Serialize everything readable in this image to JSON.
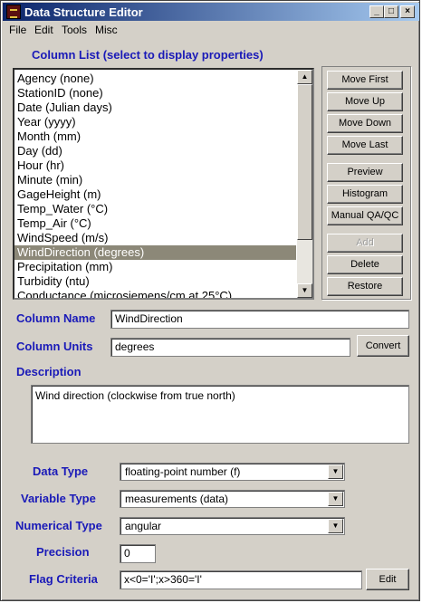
{
  "window": {
    "title": "Data Structure Editor"
  },
  "menu": [
    "File",
    "Edit",
    "Tools",
    "Misc"
  ],
  "column_list": {
    "label": "Column List (select to display properties)",
    "items": [
      "Agency (none)",
      "StationID (none)",
      "Date (Julian days)",
      "Year (yyyy)",
      "Month (mm)",
      "Day (dd)",
      "Hour (hr)",
      "Minute (min)",
      "GageHeight (m)",
      "Temp_Water (°C)",
      "Temp_Air (°C)",
      "WindSpeed (m/s)",
      "WindDirection (degrees)",
      "Precipitation (mm)",
      "Turbidity (ntu)",
      "Conductance (microsiemens/cm at 25°C)"
    ],
    "selected": "WindDirection (degrees)"
  },
  "buttons": {
    "move_first": "Move First",
    "move_up": "Move Up",
    "move_down": "Move Down",
    "move_last": "Move Last",
    "preview": "Preview",
    "histogram": "Histogram",
    "manual_qa": "Manual QA/QC",
    "add": "Add",
    "delete": "Delete",
    "restore": "Restore",
    "convert": "Convert",
    "edit": "Edit"
  },
  "properties": {
    "column_name_label": "Column Name",
    "column_name_value": "WindDirection",
    "column_units_label": "Column Units",
    "column_units_value": "degrees",
    "description_label": "Description",
    "description_value": "Wind direction (clockwise from true north)",
    "data_type_label": "Data Type",
    "data_type_value": "floating-point number (f)",
    "variable_type_label": "Variable Type",
    "variable_type_value": "measurements (data)",
    "numerical_type_label": "Numerical Type",
    "numerical_type_value": "angular",
    "precision_label": "Precision",
    "precision_value": "0",
    "flag_criteria_label": "Flag Criteria",
    "flag_criteria_value": "x<0='I';x>360='I'"
  }
}
